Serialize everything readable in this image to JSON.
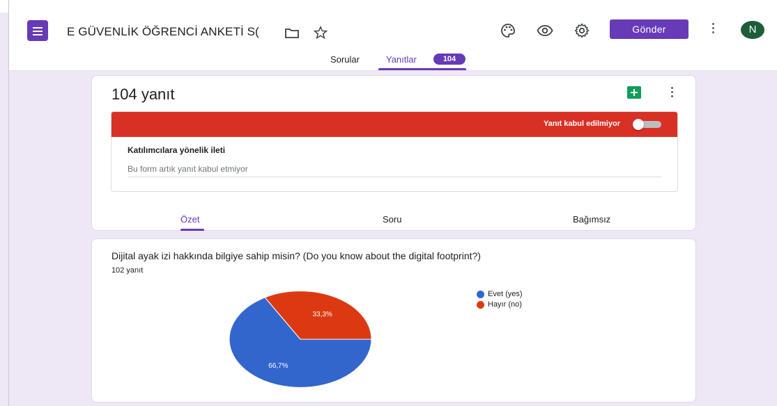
{
  "header": {
    "title": "E GÜVENLİK ÖĞRENCİ ANKETİ S(",
    "send_label": "Gönder",
    "avatar_initial": "N",
    "icons": [
      "palette-icon",
      "eye-icon",
      "settings-icon",
      "more-vert-icon",
      "folder-icon",
      "star-icon"
    ]
  },
  "tabs": [
    {
      "label": "Sorular"
    },
    {
      "label": "Yanıtlar",
      "badge": "104"
    }
  ],
  "summary": {
    "response_count_label": "104 yanıt",
    "accepting_label": "Yanıt kabul edilmiyor",
    "accepting": false,
    "message_label": "Katılımcılara yönelik ileti",
    "message_placeholder": "Bu form artık yanıt kabul etmiyor",
    "subtabs": [
      "Özet",
      "Soru",
      "Bağımsız"
    ]
  },
  "question": {
    "title": "Dijital ayak izi hakkında bilgiye sahip misin? (Do you know about the digital footprint?)",
    "response_count": "102 yanıt"
  },
  "colors": {
    "accent": "#673ab7",
    "red_bar": "#d93025",
    "yes": "#3366cc",
    "no": "#dc3912"
  },
  "chart_data": {
    "type": "pie",
    "categories": [
      "Evet (yes)",
      "Hayır (no)"
    ],
    "values": [
      66.7,
      33.3
    ],
    "labels": [
      "66,7%",
      "33,3%"
    ],
    "colors": [
      "#3366cc",
      "#dc3912"
    ],
    "legend_position": "right"
  }
}
